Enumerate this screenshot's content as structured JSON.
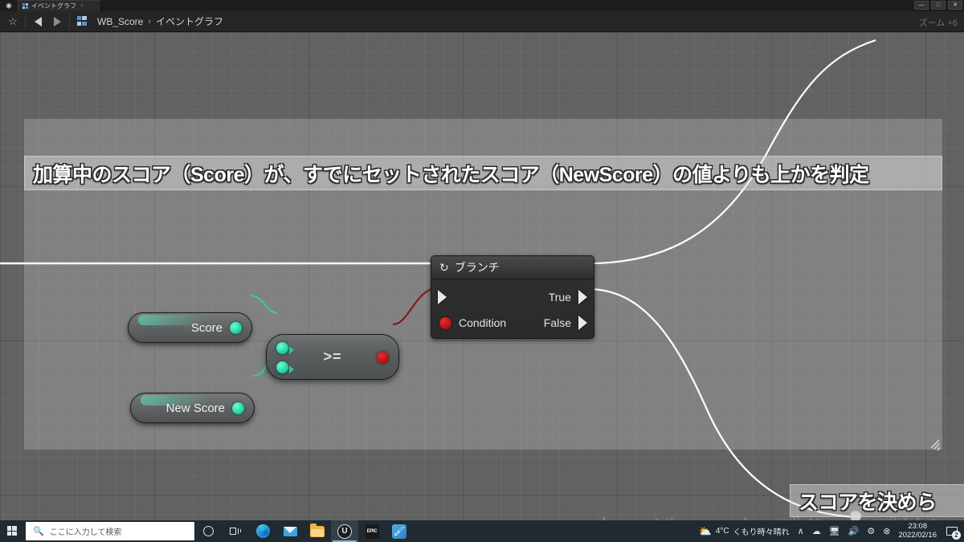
{
  "window": {
    "app_icon": "unreal-engine-logo",
    "tab_label": "イベントグラフ",
    "tab_close": "×",
    "minimize": "—",
    "maximize": "□",
    "close": "✕"
  },
  "toolbar": {
    "favorite_icon": "☆",
    "back_icon": "back-arrow",
    "forward_icon": "forward-arrow",
    "blueprint_icon": "blueprint-grid-icon",
    "breadcrumb_root": "WB_Score",
    "breadcrumb_sep": "›",
    "breadcrumb_current": "イベントグラフ",
    "zoom_label": "ズーム +6"
  },
  "graph": {
    "watermark": "ウィジェット ブルー プリント",
    "comments": [
      {
        "id": "main-comment",
        "text": "加算中のスコア（Score）が、すでにセットされたスコア（NewScore）の値よりも上かを判定"
      },
      {
        "id": "score-comment",
        "text": "スコアを決めら"
      }
    ],
    "nodes": {
      "branch": {
        "title": "ブランチ",
        "icon": "branch-refresh-icon",
        "exec_in": "",
        "condition_label": "Condition",
        "true_label": "True",
        "false_label": "False"
      },
      "compare": {
        "operator": ">=",
        "input_a_pin": "green-pin",
        "input_b_pin": "green-pin",
        "output_pin": "red-pin"
      },
      "variables": [
        {
          "label": "Score",
          "pin": "green-pin"
        },
        {
          "label": "New Score",
          "pin": "green-pin"
        }
      ]
    },
    "colors": {
      "exec_wire": "#ffffff",
      "bool_wire": "#8a1111",
      "int_wire": "#28d6a6",
      "canvas": "#626262",
      "node_body": "#5b5f5f",
      "branch_body": "#2e2e2e"
    }
  },
  "taskbar": {
    "start_icon": "windows-start-icon",
    "search_icon": "search-icon",
    "search_placeholder": "ここに入力して検索",
    "cortana_icon": "cortana-circle-icon",
    "taskview_icon": "task-view-icon",
    "apps": [
      {
        "name": "edge-icon",
        "label": ""
      },
      {
        "name": "mail-icon",
        "label": ""
      },
      {
        "name": "file-explorer-icon",
        "label": ""
      },
      {
        "name": "unreal-engine-icon",
        "label": "U"
      },
      {
        "name": "epic-games-icon",
        "label": "EPIC"
      },
      {
        "name": "paint-icon",
        "label": "🖌"
      }
    ],
    "tray": {
      "weather_icon": "partly-cloudy-icon",
      "weather_temp": "4°C",
      "weather_text": "くもり時々晴れ",
      "chevron_icon": "∧",
      "onedrive_icon": "onedrive-icon",
      "network_icon": "network-icon",
      "volume_icon": "volume-icon",
      "bluetooth_icon": "bluetooth-icon",
      "safely_remove_icon": "eject-icon",
      "time": "23:08",
      "date": "2022/02/16",
      "notification_icon": "notification-icon",
      "notification_count": "2"
    }
  }
}
